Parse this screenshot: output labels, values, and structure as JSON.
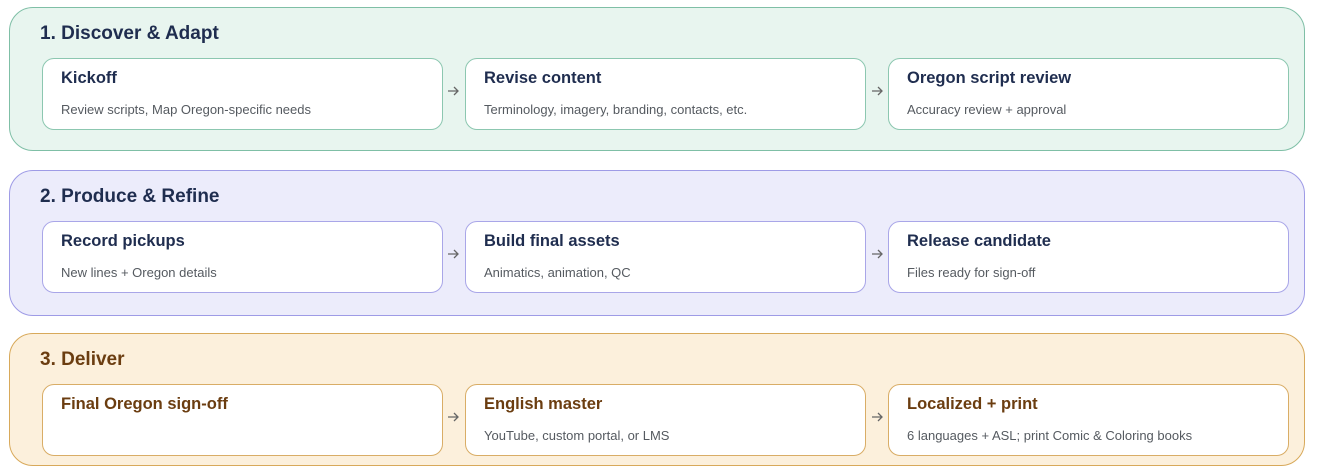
{
  "phases": [
    {
      "title": "1. Discover & Adapt",
      "colors": {
        "bg": "#e8f5ef",
        "border": "#7fbfa6",
        "card_border": "#8cc7b0",
        "title": "#1f2d4f"
      },
      "steps": [
        {
          "title": "Kickoff",
          "desc": "Review scripts, Map Oregon-specific needs"
        },
        {
          "title": "Revise content",
          "desc": "Terminology, imagery, branding, contacts, etc."
        },
        {
          "title": "Oregon script review",
          "desc": "Accuracy review + approval"
        }
      ]
    },
    {
      "title": "2. Produce & Refine",
      "colors": {
        "bg": "#ececfb",
        "border": "#9e9be6",
        "card_border": "#a9a6e8",
        "title": "#1f2d4f"
      },
      "steps": [
        {
          "title": "Record pickups",
          "desc": "New lines + Oregon details"
        },
        {
          "title": "Build final assets",
          "desc": "Animatics, animation, QC"
        },
        {
          "title": "Release candidate",
          "desc": "Files ready for sign-off"
        }
      ]
    },
    {
      "title": "3. Deliver",
      "colors": {
        "bg": "#fcf0dc",
        "border": "#d8a95a",
        "card_border": "#d9ad66",
        "title": "#6b3d10"
      },
      "steps": [
        {
          "title": "Final Oregon sign-off",
          "desc": ""
        },
        {
          "title": "English master",
          "desc": "YouTube, custom portal, or LMS"
        },
        {
          "title": "Localized + print",
          "desc": "6 languages + ASL; print Comic & Coloring books"
        }
      ]
    }
  ],
  "icons": {
    "arrow": "arrow-right-icon"
  }
}
